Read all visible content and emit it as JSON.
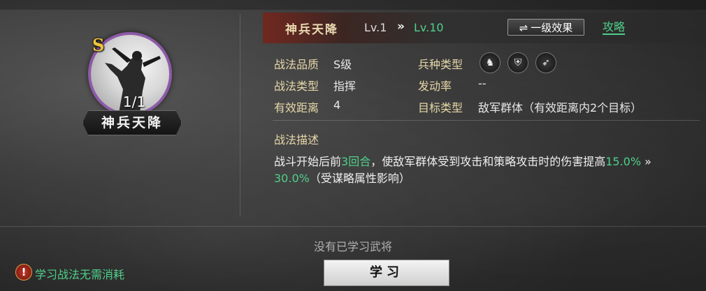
{
  "skill": {
    "grade_badge": "S",
    "count": "1/1",
    "name_plate": "神兵天降",
    "title": "神兵天降",
    "level_current": "Lv.1",
    "level_arrow": "»",
    "level_max": "Lv.10",
    "effect_button": "一级效果",
    "effect_swap_icon": "⇌",
    "guide_link": "攻略"
  },
  "attributes": {
    "quality_label": "战法品质",
    "quality_value": "S级",
    "type_label": "战法类型",
    "type_value": "指挥",
    "range_label": "有效距离",
    "range_value": "4",
    "unit_label": "兵种类型",
    "unit_icons": [
      "cavalry-icon",
      "shield-icon",
      "bow-icon"
    ],
    "trigger_label": "发动率",
    "trigger_value": "--",
    "target_label": "目标类型",
    "target_value": "敌军群体（有效距离内2个目标）"
  },
  "description": {
    "title": "战法描述",
    "part1": "战斗开始后前",
    "rounds": "3回合",
    "part2": "，使敌军群体受到攻击和策略攻击时的伤害提高",
    "value_from": "15.0%",
    "arrow": "»",
    "value_to": "30.0%",
    "part3": "（受谋略属性影响）"
  },
  "footer": {
    "no_learned": "没有已学习武将",
    "learn_button": "学习",
    "free_note": "学习战法无需消耗",
    "warning_glyph": "!"
  },
  "colors": {
    "accent_green": "#4fd08a",
    "label_gold": "#e6d7a8",
    "grade_gold": "#f0c43a",
    "frame_purple": "#8d5aa8"
  }
}
